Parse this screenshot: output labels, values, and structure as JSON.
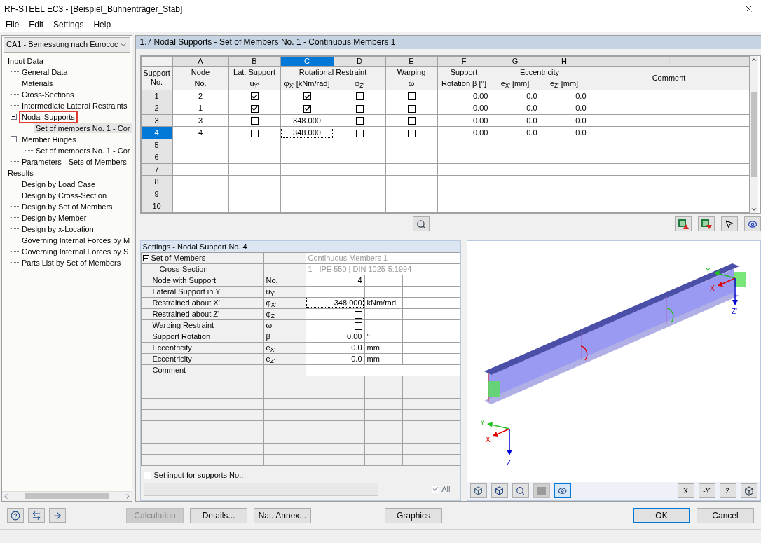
{
  "window": {
    "title": "RF-STEEL EC3 - [Beispiel_Bühnenträger_Stab]"
  },
  "menu": [
    {
      "label": "File"
    },
    {
      "label": "Edit"
    },
    {
      "label": "Settings"
    },
    {
      "label": "Help"
    }
  ],
  "sidebar": {
    "case_select": "CA1 - Bemessung nach Eurococ",
    "tree": [
      {
        "label": "Input Data",
        "selected": false,
        "children": [
          {
            "label": "General Data",
            "selected": false
          },
          {
            "label": "Materials",
            "selected": false
          },
          {
            "label": "Cross-Sections",
            "selected": false
          },
          {
            "label": "Intermediate Lateral Restraints",
            "selected": false
          },
          {
            "label": "Nodal Supports",
            "selected": false,
            "outlined": true,
            "expanded": true,
            "children": [
              {
                "label": "Set of members No. 1 - Cor",
                "selected": true
              }
            ]
          },
          {
            "label": "Member Hinges",
            "selected": false,
            "expanded": true,
            "children": [
              {
                "label": "Set of members No. 1 - Cor",
                "selected": false
              }
            ]
          },
          {
            "label": "Parameters - Sets of Members",
            "selected": false
          }
        ]
      },
      {
        "label": "Results",
        "selected": false,
        "children": [
          {
            "label": "Design by Load Case",
            "selected": false
          },
          {
            "label": "Design by Cross-Section",
            "selected": false
          },
          {
            "label": "Design by Set of Members",
            "selected": false
          },
          {
            "label": "Design by Member",
            "selected": false
          },
          {
            "label": "Design by x-Location",
            "selected": false
          },
          {
            "label": "Governing Internal Forces by M",
            "selected": false
          },
          {
            "label": "Governing Internal Forces by S",
            "selected": false
          },
          {
            "label": "Parts List by Set of Members",
            "selected": false
          }
        ]
      }
    ]
  },
  "page_title": "1.7 Nodal Supports - Set of Members No. 1 - Continuous Members 1",
  "table": {
    "row_header": "Support No.",
    "letters": [
      {
        "label": "A",
        "selected": false
      },
      {
        "label": "B",
        "selected": false
      },
      {
        "label": "C",
        "selected": true
      },
      {
        "label": "D",
        "selected": false
      },
      {
        "label": "E",
        "selected": false
      },
      {
        "label": "F",
        "selected": false
      },
      {
        "label": "G",
        "selected": false
      },
      {
        "label": "H",
        "selected": false
      },
      {
        "label": "I",
        "selected": false
      }
    ],
    "groups": [
      {
        "label": "Node",
        "subheaders": [
          "No."
        ]
      },
      {
        "label": "Lat. Support",
        "subheaders": [
          "u$_{Y'}$"
        ]
      },
      {
        "label": "Rotational Restraint",
        "subheaders": [
          "φ$_{X'}$ [kNm/rad]",
          "φ$_{Z'}$"
        ]
      },
      {
        "label": "Warping",
        "subheaders": [
          "ω"
        ]
      },
      {
        "label": "Support",
        "subheaders": [
          "Rotation β [°]"
        ]
      },
      {
        "label": "Eccentricity",
        "subheaders": [
          "e$_{X'}$ [mm]",
          "e$_{Z'}$ [mm]"
        ]
      }
    ],
    "comment_header": "Comment",
    "rows": [
      {
        "no": "1",
        "selected": false,
        "node": "2",
        "lat_support": {
          "checked": true
        },
        "phi_x": {
          "kind": "check",
          "checked": true
        },
        "phi_z": {
          "checked": false
        },
        "warping": {
          "checked": false
        },
        "rotation": "0.00",
        "ex": "0.0",
        "ez": "0.0"
      },
      {
        "no": "2",
        "selected": false,
        "node": "1",
        "lat_support": {
          "checked": true
        },
        "phi_x": {
          "kind": "check",
          "checked": true
        },
        "phi_z": {
          "checked": false
        },
        "warping": {
          "checked": false
        },
        "rotation": "0.00",
        "ex": "0.0",
        "ez": "0.0"
      },
      {
        "no": "3",
        "selected": false,
        "node": "3",
        "lat_support": {
          "checked": false
        },
        "phi_x": {
          "kind": "value",
          "value": "348.000",
          "focused": false
        },
        "phi_z": {
          "checked": false
        },
        "warping": {
          "checked": false
        },
        "rotation": "0.00",
        "ex": "0.0",
        "ez": "0.0"
      },
      {
        "no": "4",
        "selected": true,
        "node": "4",
        "lat_support": {
          "checked": false
        },
        "phi_x": {
          "kind": "value",
          "value": "348.000",
          "focused": true
        },
        "phi_z": {
          "checked": false
        },
        "warping": {
          "checked": false
        },
        "rotation": "0.00",
        "ex": "0.0",
        "ez": "0.0"
      },
      {
        "no": "5",
        "selected": false
      },
      {
        "no": "6",
        "selected": false
      },
      {
        "no": "7",
        "selected": false
      },
      {
        "no": "8",
        "selected": false
      },
      {
        "no": "9",
        "selected": false
      },
      {
        "no": "10",
        "selected": false
      }
    ]
  },
  "settings": {
    "title": "Settings - Nodal Support No. 4",
    "rows": [
      {
        "kind": "group",
        "label": "Set of Members",
        "expanded": true,
        "value": "Continuous Members 1"
      },
      {
        "kind": "child",
        "label": "Cross-Section",
        "value": "1 - IPE 550 | DIN 1025-5:1994"
      },
      {
        "kind": "value",
        "label": "Node with Support",
        "symbol": "No.",
        "value": "4",
        "focused": false
      },
      {
        "kind": "check",
        "label": "Lateral Support in Y'",
        "symbol": "u$_{Y'}$",
        "checked": false
      },
      {
        "kind": "value",
        "label": "Restrained about X'",
        "symbol": "φ$_{X'}$",
        "value": "348.000",
        "unit": "kNm/rad",
        "focused": true
      },
      {
        "kind": "check",
        "label": "Restrained about Z'",
        "symbol": "φ$_{Z'}$",
        "checked": false
      },
      {
        "kind": "check",
        "label": "Warping Restraint",
        "symbol": "ω",
        "checked": false
      },
      {
        "kind": "value",
        "label": "Support Rotation",
        "symbol": "β",
        "value": "0.00",
        "unit": "°",
        "focused": false
      },
      {
        "kind": "value",
        "label": "Eccentricity",
        "symbol": "e$_{X'}$",
        "value": "0.0",
        "unit": "mm",
        "focused": false
      },
      {
        "kind": "value",
        "label": "Eccentricity",
        "symbol": "e$_{Z'}$",
        "value": "0.0",
        "unit": "mm",
        "focused": false
      },
      {
        "kind": "comment",
        "label": "Comment"
      }
    ],
    "set_input": {
      "label": "Set input for supports No.:",
      "checked": false
    },
    "all": {
      "label": "All",
      "checked": true,
      "disabled": true
    }
  },
  "graphic": {
    "local_axes": [
      "Y'",
      "X'",
      "Z'"
    ],
    "global_axes": [
      "Y",
      "X",
      "Z"
    ],
    "view_buttons": [
      {
        "label": "X"
      },
      {
        "label": "-Y"
      },
      {
        "label": "Z"
      }
    ]
  },
  "buttons": [
    {
      "label": "Calculation",
      "disabled": true
    },
    {
      "label": "Details...",
      "disabled": false
    },
    {
      "label": "Nat. Annex...",
      "disabled": false
    },
    {
      "label": "Graphics",
      "disabled": false
    },
    {
      "label": "OK",
      "disabled": false
    },
    {
      "label": "Cancel",
      "disabled": false
    }
  ]
}
